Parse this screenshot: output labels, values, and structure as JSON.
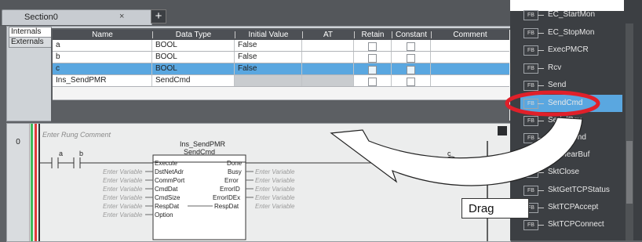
{
  "section_tab": {
    "label": "Section0",
    "close_glyph": "×",
    "add_glyph": "+"
  },
  "side_tabs": [
    "Internals",
    "Externals"
  ],
  "columns": [
    "Name",
    "Data Type",
    "Initial Value",
    "AT",
    "Retain",
    "Constant",
    "Comment"
  ],
  "rows": [
    {
      "name": "a",
      "type": "BOOL",
      "init": "False",
      "selected": false
    },
    {
      "name": "b",
      "type": "BOOL",
      "init": "False",
      "selected": false
    },
    {
      "name": "c",
      "type": "BOOL",
      "init": "False",
      "selected": true
    },
    {
      "name": "Ins_SendPMR",
      "type": "SendCmd",
      "init": "",
      "selected": false
    }
  ],
  "ladder": {
    "rung_number": "0",
    "rung_comment": "Enter Rung Comment",
    "contact_a": "a",
    "contact_b": "b",
    "coil_c": "c",
    "instance_name": "Ins_SendPMR",
    "fb_type": "SendCmd",
    "inputs": [
      "Execute",
      "DstNetAdr",
      "CommPort",
      "CmdDat",
      "CmdSize",
      "RespDat",
      "Option"
    ],
    "outputs": [
      "Done",
      "Busy",
      "Error",
      "ErrorID",
      "ErrorIDEx",
      "RespDat"
    ],
    "enter_variable": "Enter Variable"
  },
  "palette": {
    "badge": "FB",
    "items": [
      {
        "label": "EC_StartMon",
        "selected": false
      },
      {
        "label": "EC_StopMon",
        "selected": false
      },
      {
        "label": "ExecPMCR",
        "selected": false
      },
      {
        "label": "Rcv",
        "selected": false
      },
      {
        "label": "Send",
        "selected": false
      },
      {
        "label": "SendCmd",
        "selected": true
      },
      {
        "label": "SerialRcv",
        "selected": false
      },
      {
        "label": "SerialSend",
        "selected": false
      },
      {
        "label": "SktClearBuf",
        "selected": false
      },
      {
        "label": "SktClose",
        "selected": false
      },
      {
        "label": "SktGetTCPStatus",
        "selected": false
      },
      {
        "label": "SktTCPAccept",
        "selected": false
      },
      {
        "label": "SktTCPConnect",
        "selected": false
      }
    ]
  },
  "annotation": {
    "drag_label": "Drag",
    "highlight_color": "#e0202a"
  }
}
